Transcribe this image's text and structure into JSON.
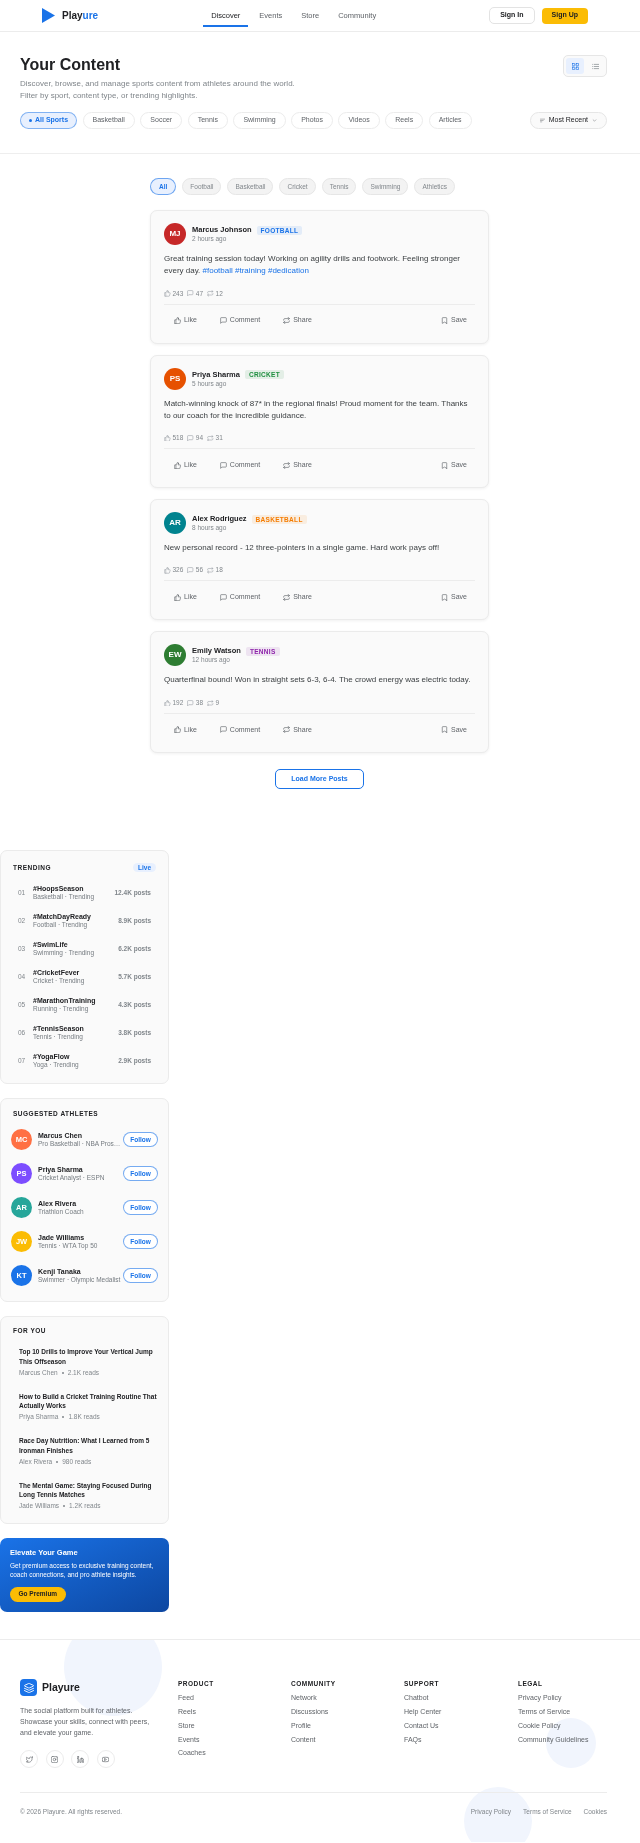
{
  "header": {
    "logo": {
      "text": "Play",
      "accent": "ure"
    },
    "nav": [
      {
        "label": "Discover",
        "selected": true
      },
      {
        "label": "Events",
        "selected": false
      },
      {
        "label": "Store",
        "selected": false
      },
      {
        "label": "Community",
        "selected": false
      }
    ],
    "buttons": [
      {
        "kind": "sign_in",
        "label": "Sign In"
      },
      {
        "kind": "sign_up",
        "label": "Sign Up"
      }
    ]
  },
  "page_header": {
    "title": "Your Content",
    "description": "Discover, browse, and manage sports content from athletes around the world. Filter by sport, content type, or trending highlights.",
    "view_toggle": [
      {
        "kind": "grid",
        "selected": true
      },
      {
        "kind": "list",
        "selected": false
      }
    ]
  },
  "category_filters": [
    {
      "label": "All Sports",
      "selected": true
    },
    {
      "label": "Basketball",
      "selected": false
    },
    {
      "label": "Soccer",
      "selected": false
    },
    {
      "label": "Tennis",
      "selected": false
    },
    {
      "label": "Swimming",
      "selected": false
    },
    {
      "label": "Photos",
      "selected": false
    },
    {
      "label": "Videos",
      "selected": false
    },
    {
      "label": "Reels",
      "selected": false
    },
    {
      "label": "Articles",
      "selected": false
    }
  ],
  "sort": {
    "label": "Most Recent"
  },
  "feed": {
    "sport_filters": [
      {
        "label": "All",
        "selected": true
      },
      {
        "label": "Football",
        "selected": false
      },
      {
        "label": "Basketball",
        "selected": false
      },
      {
        "label": "Cricket",
        "selected": false
      },
      {
        "label": "Tennis",
        "selected": false
      },
      {
        "label": "Swimming",
        "selected": false
      },
      {
        "label": "Athletics",
        "selected": false
      }
    ],
    "posts": [
      {
        "author": "Marcus Johnson",
        "avatar": {
          "initials": "MJ",
          "color": "#c62828"
        },
        "tag": {
          "label": "FOOTBALL",
          "color": "#1a73e8"
        },
        "time": "2 hours ago",
        "text": "Great training session today! Working on agility drills and footwork. Feeling stronger every day.",
        "hashtags": [
          "#football",
          "#training",
          "#dedication"
        ],
        "stats": [
          {
            "kind": "likes",
            "value": "243"
          },
          {
            "kind": "comments",
            "value": "47"
          },
          {
            "kind": "shares",
            "value": "12"
          }
        ],
        "actions": [
          {
            "kind": "like",
            "label": "Like"
          },
          {
            "kind": "comment",
            "label": "Comment"
          },
          {
            "kind": "share",
            "label": "Share"
          },
          {
            "kind": "save",
            "label": "Save"
          }
        ]
      },
      {
        "author": "Priya Sharma",
        "avatar": {
          "initials": "PS",
          "color": "#e65100"
        },
        "tag": {
          "label": "CRICKET",
          "color": "#1e8e3e"
        },
        "time": "5 hours ago",
        "text": "Match-winning knock of 87* in the regional finals! Proud moment for the team. Thanks to our coach for the incredible guidance.",
        "stats": [
          {
            "kind": "likes",
            "value": "518"
          },
          {
            "kind": "comments",
            "value": "94"
          },
          {
            "kind": "shares",
            "value": "31"
          }
        ],
        "actions": [
          {
            "kind": "like",
            "label": "Like"
          },
          {
            "kind": "comment",
            "label": "Comment"
          },
          {
            "kind": "share",
            "label": "Share"
          },
          {
            "kind": "save",
            "label": "Save"
          }
        ]
      },
      {
        "author": "Alex Rodriguez",
        "avatar": {
          "initials": "AR",
          "color": "#00838f"
        },
        "tag": {
          "label": "BASKETBALL",
          "color": "#f57c00"
        },
        "time": "8 hours ago",
        "text": "New personal record - 12 three-pointers in a single game. Hard work pays off!",
        "stats": [
          {
            "kind": "likes",
            "value": "326"
          },
          {
            "kind": "comments",
            "value": "56"
          },
          {
            "kind": "shares",
            "value": "18"
          }
        ],
        "actions": [
          {
            "kind": "like",
            "label": "Like"
          },
          {
            "kind": "comment",
            "label": "Comment"
          },
          {
            "kind": "share",
            "label": "Share"
          },
          {
            "kind": "save",
            "label": "Save"
          }
        ]
      },
      {
        "author": "Emily Watson",
        "avatar": {
          "initials": "EW",
          "color": "#2e7d32"
        },
        "tag": {
          "label": "TENNIS",
          "color": "#8e24aa"
        },
        "time": "12 hours ago",
        "text": "Quarterfinal bound! Won in straight sets 6-3, 6-4. The crowd energy was electric today.",
        "stats": [
          {
            "kind": "likes",
            "value": "192"
          },
          {
            "kind": "comments",
            "value": "38"
          },
          {
            "kind": "shares",
            "value": "9"
          }
        ],
        "actions": [
          {
            "kind": "like",
            "label": "Like"
          },
          {
            "kind": "comment",
            "label": "Comment"
          },
          {
            "kind": "share",
            "label": "Share"
          },
          {
            "kind": "save",
            "label": "Save"
          }
        ]
      }
    ],
    "load_more": "Load More Posts"
  },
  "sidebar": {
    "trending": {
      "title": "TRENDING",
      "badge": "Live",
      "items": [
        {
          "rank": "01",
          "tag": "#HoopsSeason",
          "meta": "Basketball · Trending",
          "count": "12.4K posts"
        },
        {
          "rank": "02",
          "tag": "#MatchDayReady",
          "meta": "Football · Trending",
          "count": "8.9K posts"
        },
        {
          "rank": "03",
          "tag": "#SwimLife",
          "meta": "Swimming · Trending",
          "count": "6.2K posts"
        },
        {
          "rank": "04",
          "tag": "#CricketFever",
          "meta": "Cricket · Trending",
          "count": "5.7K posts"
        },
        {
          "rank": "05",
          "tag": "#MarathonTraining",
          "meta": "Running · Trending",
          "count": "4.3K posts"
        },
        {
          "rank": "06",
          "tag": "#TennisSeason",
          "meta": "Tennis · Trending",
          "count": "3.8K posts"
        },
        {
          "rank": "07",
          "tag": "#YogaFlow",
          "meta": "Yoga · Trending",
          "count": "2.9K posts"
        }
      ]
    },
    "suggested_athletes": {
      "title": "SUGGESTED ATHLETES",
      "items": [
        {
          "initials": "MC",
          "color": "#ff7043",
          "name": "Marcus Chen",
          "meta": "Pro Basketball · NBA Pros…",
          "button": "Follow"
        },
        {
          "initials": "PS",
          "color": "#7c4dff",
          "name": "Priya Sharma",
          "meta": "Cricket Analyst · ESPN",
          "button": "Follow"
        },
        {
          "initials": "AR",
          "color": "#26a69a",
          "name": "Alex Rivera",
          "meta": "Triathlon Coach",
          "button": "Follow"
        },
        {
          "initials": "JW",
          "color": "#fbbc04",
          "name": "Jade Williams",
          "meta": "Tennis · WTA Top 50",
          "button": "Follow"
        },
        {
          "initials": "KT",
          "color": "#1a73e8",
          "name": "Kenji Tanaka",
          "meta": "Swimmer · Olympic Medalist",
          "button": "Follow"
        }
      ]
    },
    "for_you": {
      "title": "FOR YOU",
      "items": [
        {
          "title": "Top 10 Drills to Improve Your Vertical Jump This Offseason",
          "author": "Marcus Chen",
          "reads": "2.1K reads"
        },
        {
          "title": "How to Build a Cricket Training Routine That Actually Works",
          "author": "Priya Sharma",
          "reads": "1.8K reads"
        },
        {
          "title": "Race Day Nutrition: What I Learned from 5 Ironman Finishes",
          "author": "Alex Rivera",
          "reads": "980 reads"
        },
        {
          "title": "The Mental Game: Staying Focused During Long Tennis Matches",
          "author": "Jade Williams",
          "reads": "1.2K reads"
        }
      ]
    },
    "premium": {
      "title": "Elevate Your Game",
      "text": "Get premium access to exclusive training content, coach connections, and pro athlete insights.",
      "button": "Go Premium"
    }
  },
  "footer": {
    "brand": "Playure",
    "description": "The social platform built for athletes. Showcase your skills, connect with peers, and elevate your game.",
    "social": [
      {
        "kind": "twitter"
      },
      {
        "kind": "instagram"
      },
      {
        "kind": "linkedin"
      },
      {
        "kind": "youtube"
      }
    ],
    "columns": [
      {
        "title": "PRODUCT",
        "links": [
          "Feed",
          "Reels",
          "Store",
          "Events",
          "Coaches"
        ]
      },
      {
        "title": "COMMUNITY",
        "links": [
          "Network",
          "Discussions",
          "Profile",
          "Content"
        ]
      },
      {
        "title": "SUPPORT",
        "links": [
          "Chatbot",
          "Help Center",
          "Contact Us",
          "FAQs"
        ]
      },
      {
        "title": "LEGAL",
        "links": [
          "Privacy Policy",
          "Terms of Service",
          "Cookie Policy",
          "Community Guidelines"
        ]
      }
    ],
    "copyright": "© 2026 Playure. All rights reserved.",
    "legal_links": [
      "Privacy Policy",
      "Terms of Service",
      "Cookies"
    ]
  }
}
